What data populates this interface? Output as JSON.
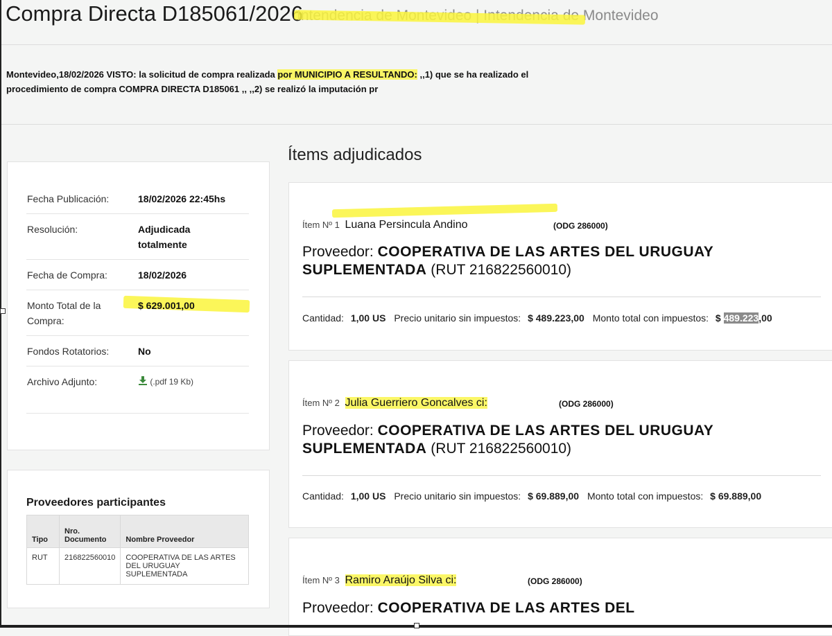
{
  "header": {
    "title": "Compra Directa D185061/2026",
    "subtitle": "Intendencia de Montevideo | Intendencia de Montevideo"
  },
  "summary": {
    "before": "Montevideo,18/02/2026 VISTO: la solicitud de compra realizada ",
    "highlighted": "por MUNICIPIO A RESULTANDO:",
    "after": " ,,1) que se ha realizado el procedimiento de compra COMPRA DIRECTA D185061 ,, ,,2) se realizó la imputación pr"
  },
  "details": [
    {
      "label": "Fecha Publicación:",
      "value": "18/02/2026 22:45hs"
    },
    {
      "label": "Resolución:",
      "value": "Adjudicada totalmente"
    },
    {
      "label": "Fecha de Compra:",
      "value": "18/02/2026"
    },
    {
      "label": "Monto Total de la Compra:",
      "value": "$ 629.001,00"
    },
    {
      "label": "Fondos Rotatorios:",
      "value": "No"
    },
    {
      "label": "Archivo Adjunto:",
      "value": "(.pdf 19 Kb)",
      "icon": "download-icon"
    }
  ],
  "providers": {
    "title": "Proveedores participantes",
    "columns": [
      "Tipo",
      "Nro. Documento",
      "Nombre Proveedor"
    ],
    "rows": [
      [
        "RUT",
        "216822560010",
        "COOPERATIVA DE LAS ARTES DEL URUGUAY SUPLEMENTADA"
      ]
    ]
  },
  "items_heading": "Ítems adjudicados",
  "labels": {
    "proveedor": "Proveedor:",
    "cantidad": "Cantidad:",
    "precio_unitario": "Precio unitario sin impuestos:",
    "monto_total": "Monto total con impuestos:"
  },
  "items": [
    {
      "number": "Ítem Nº 1",
      "name": "Luana Persincula Andino",
      "odg": "(ODG 286000)",
      "provider_name": "COOPERATIVA DE LAS ARTES DEL URUGUAY SUPLEMENTADA",
      "rut": "(RUT 216822560010)",
      "cantidad": "1,00 US",
      "precio_unitario": "$ 489.223,00",
      "monto_prefix": "$",
      "monto_selected": "489.223",
      "monto_suffix": ",00"
    },
    {
      "number": "Ítem Nº 2",
      "name": "Julia Guerriero Goncalves ci:",
      "odg": "(ODG 286000)",
      "provider_name": "COOPERATIVA DE LAS ARTES DEL URUGUAY SUPLEMENTADA",
      "rut": "(RUT 216822560010)",
      "cantidad": "1,00 US",
      "precio_unitario": "$ 69.889,00",
      "monto_total": "$ 69.889,00"
    },
    {
      "number": "Ítem Nº 3",
      "name": "Ramiro Araújo Silva ci:",
      "odg": "(ODG 286000)",
      "provider_name": "COOPERATIVA DE LAS ARTES DEL"
    }
  ],
  "colors": {
    "highlight": "#faf53c",
    "background": "#f4f5f4",
    "card": "#ffffff",
    "download_icon": "#3c8a3c",
    "selection": "#8b8b8b"
  }
}
